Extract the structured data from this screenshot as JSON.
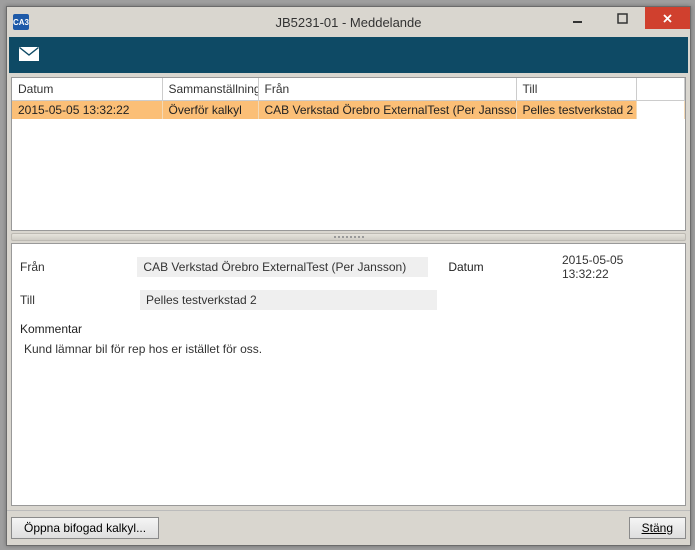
{
  "window": {
    "title": "JB5231-01 - Meddelande",
    "app_icon_text": "CA3"
  },
  "toolbar": {
    "icon": "mail-icon"
  },
  "grid": {
    "columns": {
      "datum": "Datum",
      "sammanstalln": "Sammanställning",
      "fran": "Från",
      "till": "Till"
    },
    "rows": [
      {
        "datum": "2015-05-05 13:32:22",
        "sammanstalln": "Överför kalkyl",
        "fran": "CAB Verkstad Örebro ExternalTest (Per Jansson)",
        "till": "Pelles testverkstad 2"
      }
    ]
  },
  "details": {
    "fran_label": "Från",
    "fran_value": "CAB Verkstad Örebro ExternalTest (Per Jansson)",
    "datum_label": "Datum",
    "datum_value": "2015-05-05 13:32:22",
    "till_label": "Till",
    "till_value": "Pelles testverkstad 2",
    "kommentar_label": "Kommentar",
    "kommentar_value": "Kund lämnar bil för rep hos er istället för oss."
  },
  "footer": {
    "open_attached": "Öppna bifogad kalkyl...",
    "close": "Stäng"
  }
}
